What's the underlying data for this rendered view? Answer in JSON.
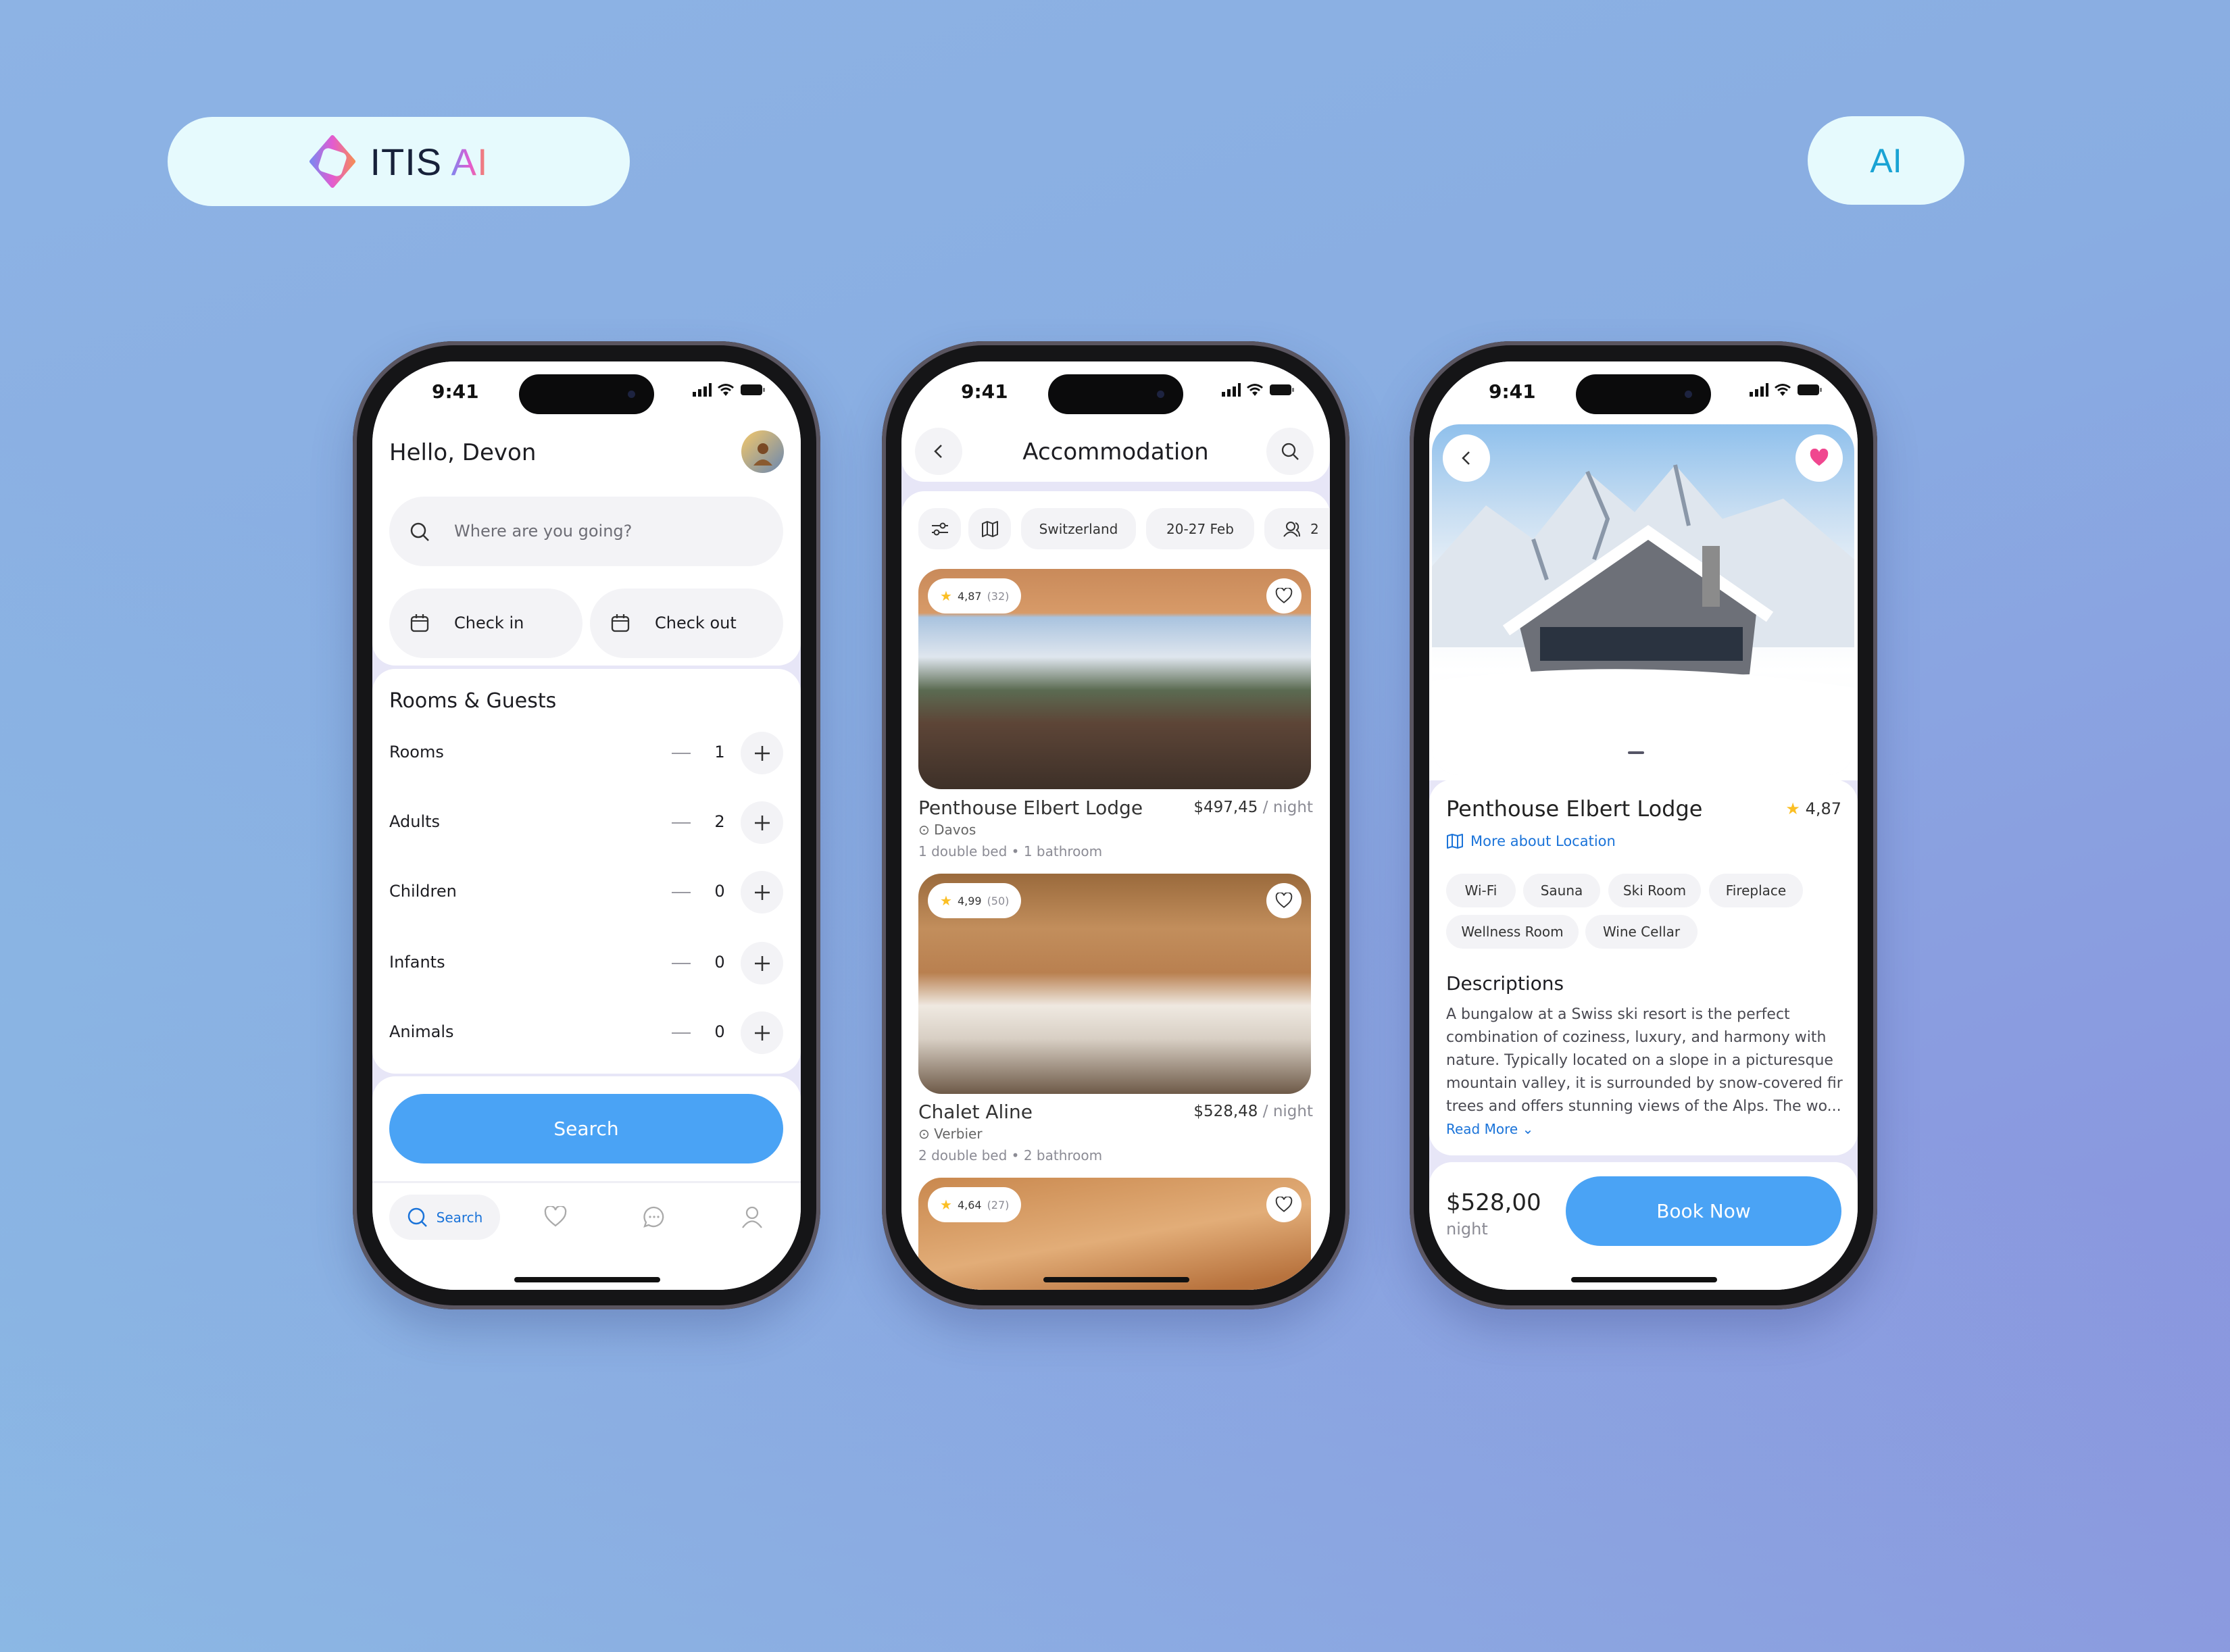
{
  "brand": {
    "name": "ITIS",
    "suffix": "AI",
    "badge": "AI"
  },
  "status": {
    "time": "9:41"
  },
  "search_screen": {
    "greeting": "Hello, Devon",
    "search_placeholder": "Where are you going?",
    "check_in": "Check in",
    "check_out": "Check out",
    "section_title": "Rooms & Guests",
    "rows": [
      {
        "label": "Rooms",
        "value": "1"
      },
      {
        "label": "Adults",
        "value": "2"
      },
      {
        "label": "Children",
        "value": "0"
      },
      {
        "label": "Infants",
        "value": "0"
      },
      {
        "label": "Animals",
        "value": "0"
      }
    ],
    "search_button": "Search",
    "nav": {
      "search": "Search"
    }
  },
  "list_screen": {
    "title": "Accommodation",
    "filters": {
      "country": "Switzerland",
      "dates": "20-27 Feb",
      "guests": "2"
    },
    "listings": [
      {
        "rating": "4,87",
        "reviews": "(32)",
        "name": "Penthouse Elbert Lodge",
        "price": "$497,45",
        "unit": "/ night",
        "location": "Davos",
        "beds": "1 double bed",
        "baths": "1 bathroom"
      },
      {
        "rating": "4,99",
        "reviews": "(50)",
        "name": "Chalet Aline",
        "price": "$528,48",
        "unit": "/ night",
        "location": "Verbier",
        "beds": "2 double bed",
        "baths": "2 bathroom"
      },
      {
        "rating": "4,64",
        "reviews": "(27)"
      }
    ]
  },
  "detail_screen": {
    "name": "Penthouse Elbert Lodge",
    "rating": "4,87",
    "location_link": "More about Location",
    "amenities": [
      "Wi-Fi",
      "Sauna",
      "Ski Room",
      "Fireplace",
      "Wellness Room",
      "Wine Cellar"
    ],
    "desc_title": "Descriptions",
    "desc_lines": [
      "A bungalow at a Swiss ski resort is the perfect",
      "combination of coziness, luxury, and harmony with",
      "nature. Typically located on a slope in a picturesque",
      "mountain valley, it is surrounded by snow-covered fir",
      "trees and offers stunning views of the Alps. The wo..."
    ],
    "read_more": "Read More",
    "price": "$528,00",
    "price_unit": "night",
    "book_button": "Book Now"
  },
  "colors": {
    "accent": "#4aa3f5",
    "link": "#1a73d9",
    "star": "#fbbf24",
    "favorite": "#f0478f"
  }
}
